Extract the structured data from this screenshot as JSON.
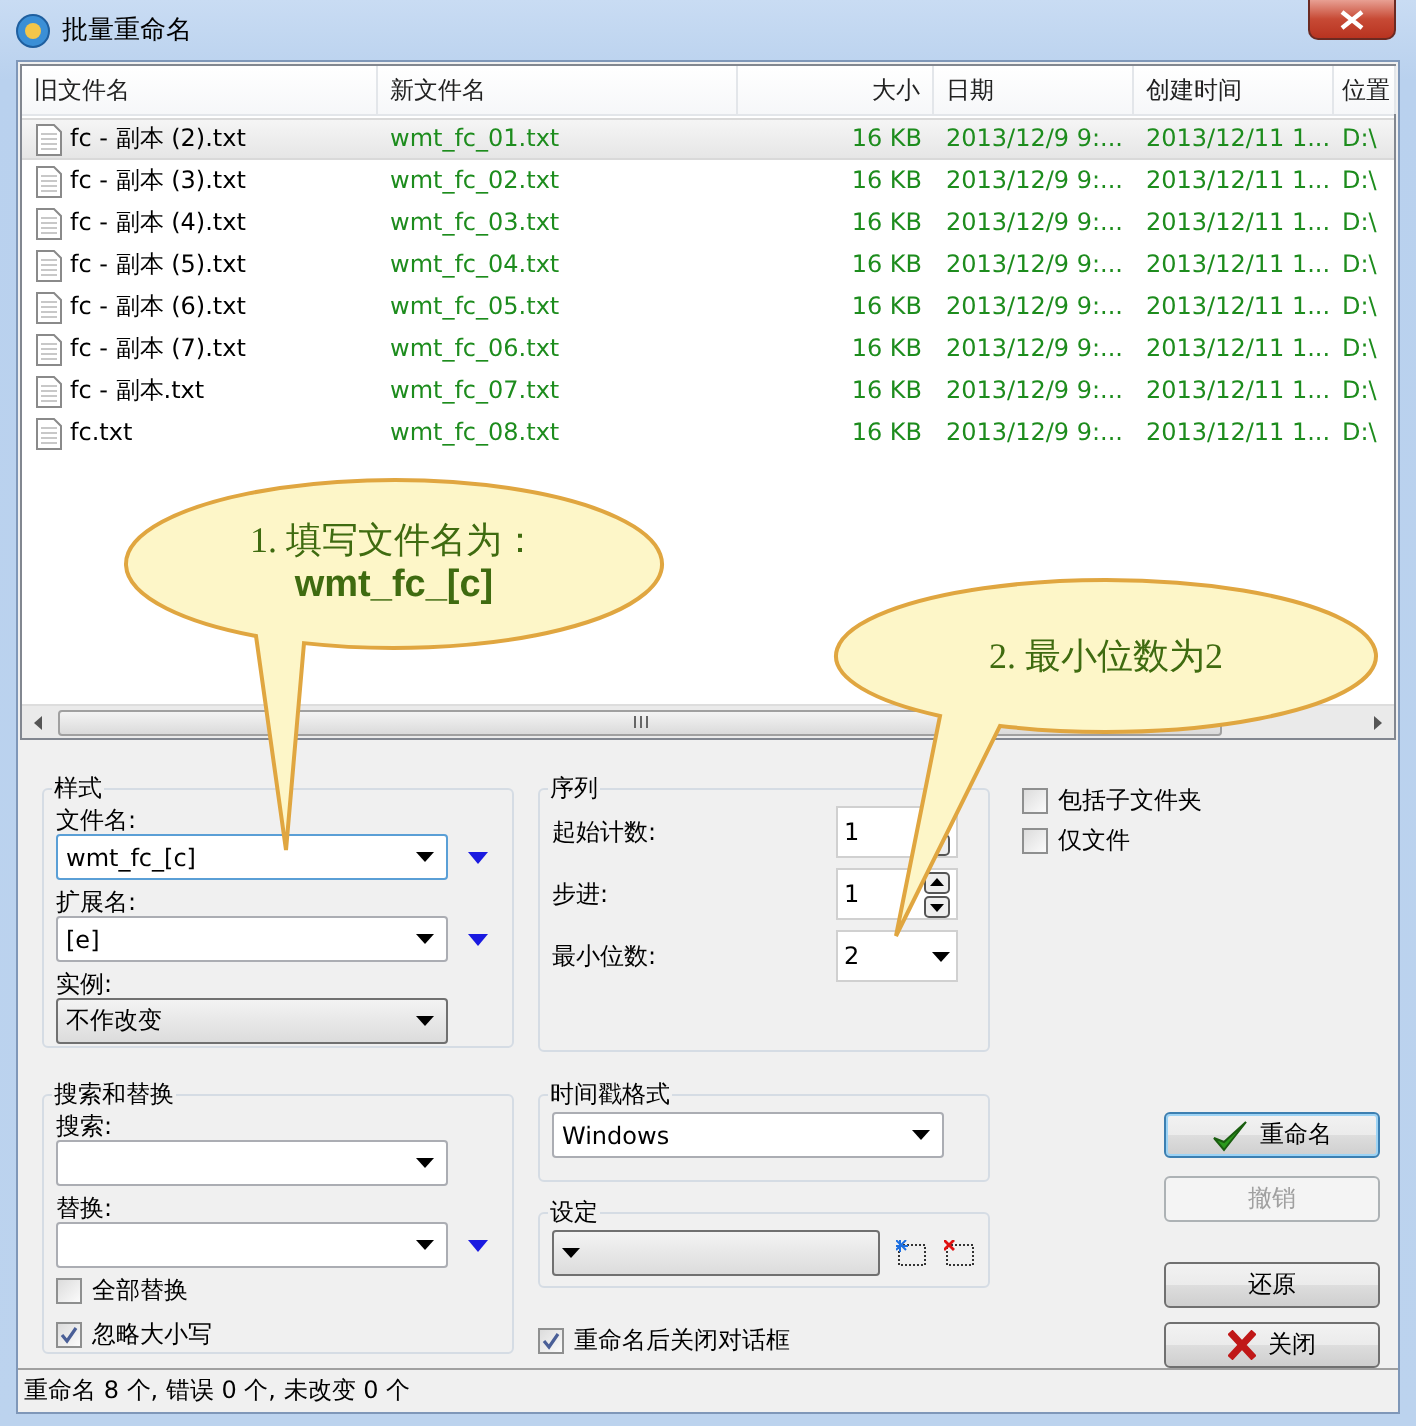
{
  "window": {
    "title": "批量重命名"
  },
  "file_list": {
    "columns": [
      "旧文件名",
      "新文件名",
      "大小",
      "日期",
      "创建时间",
      "位置"
    ],
    "rows": [
      {
        "old_name": "fc - 副本 (2).txt",
        "new_name": "wmt_fc_01.txt",
        "size": "16 KB",
        "date": "2013/12/9 9:...",
        "created": "2013/12/11 1...",
        "location": "D:\\",
        "selected": true
      },
      {
        "old_name": "fc - 副本 (3).txt",
        "new_name": "wmt_fc_02.txt",
        "size": "16 KB",
        "date": "2013/12/9 9:...",
        "created": "2013/12/11 1...",
        "location": "D:\\",
        "selected": false
      },
      {
        "old_name": "fc - 副本 (4).txt",
        "new_name": "wmt_fc_03.txt",
        "size": "16 KB",
        "date": "2013/12/9 9:...",
        "created": "2013/12/11 1...",
        "location": "D:\\",
        "selected": false
      },
      {
        "old_name": "fc - 副本 (5).txt",
        "new_name": "wmt_fc_04.txt",
        "size": "16 KB",
        "date": "2013/12/9 9:...",
        "created": "2013/12/11 1...",
        "location": "D:\\",
        "selected": false
      },
      {
        "old_name": "fc - 副本 (6).txt",
        "new_name": "wmt_fc_05.txt",
        "size": "16 KB",
        "date": "2013/12/9 9:...",
        "created": "2013/12/11 1...",
        "location": "D:\\",
        "selected": false
      },
      {
        "old_name": "fc - 副本 (7).txt",
        "new_name": "wmt_fc_06.txt",
        "size": "16 KB",
        "date": "2013/12/9 9:...",
        "created": "2013/12/11 1...",
        "location": "D:\\",
        "selected": false
      },
      {
        "old_name": "fc - 副本.txt",
        "new_name": "wmt_fc_07.txt",
        "size": "16 KB",
        "date": "2013/12/9 9:...",
        "created": "2013/12/11 1...",
        "location": "D:\\",
        "selected": false
      },
      {
        "old_name": "fc.txt",
        "new_name": "wmt_fc_08.txt",
        "size": "16 KB",
        "date": "2013/12/9 9:...",
        "created": "2013/12/11 1...",
        "location": "D:\\",
        "selected": false
      }
    ]
  },
  "callouts": [
    {
      "text": "1.  填写文件名为：",
      "emphasis": "wmt_fc_[c]"
    },
    {
      "text": "2.  最小位数为2"
    }
  ],
  "style_group": {
    "title": "样式",
    "filename_label": "文件名:",
    "filename_value": "wmt_fc_[c]",
    "extension_label": "扩展名:",
    "extension_value": "[e]",
    "case_label": "实例:",
    "case_value": "不作改变"
  },
  "search_replace": {
    "title": "搜索和替换",
    "search_label": "搜索:",
    "replace_label": "替换:",
    "replace_all": {
      "label": "全部替换",
      "checked": false
    },
    "ignore_case": {
      "label": "忽略大小写",
      "checked": true
    }
  },
  "sequence": {
    "title": "序列",
    "start_label": "起始计数:",
    "start_value": "1",
    "step_label": "步进:",
    "step_value": "1",
    "digits_label": "最小位数:",
    "digits_value": "2"
  },
  "timestamp": {
    "title": "时间戳格式",
    "value": "Windows"
  },
  "preset": {
    "title": "设定"
  },
  "close_after": {
    "label": "重命名后关闭对话框",
    "checked": true
  },
  "options": [
    {
      "label": "包括子文件夹",
      "checked": false
    },
    {
      "label": "仅文件",
      "checked": false
    }
  ],
  "buttons": [
    {
      "label": "重命名",
      "kind": "rename",
      "disabled": false
    },
    {
      "label": "撤销",
      "kind": "plain",
      "disabled": true
    },
    {
      "label": "还原",
      "kind": "plain",
      "disabled": false
    },
    {
      "label": "关闭",
      "kind": "close",
      "disabled": false
    }
  ],
  "status_bar": "重命名 8  个, 错误 0 个, 未改变 0 个"
}
